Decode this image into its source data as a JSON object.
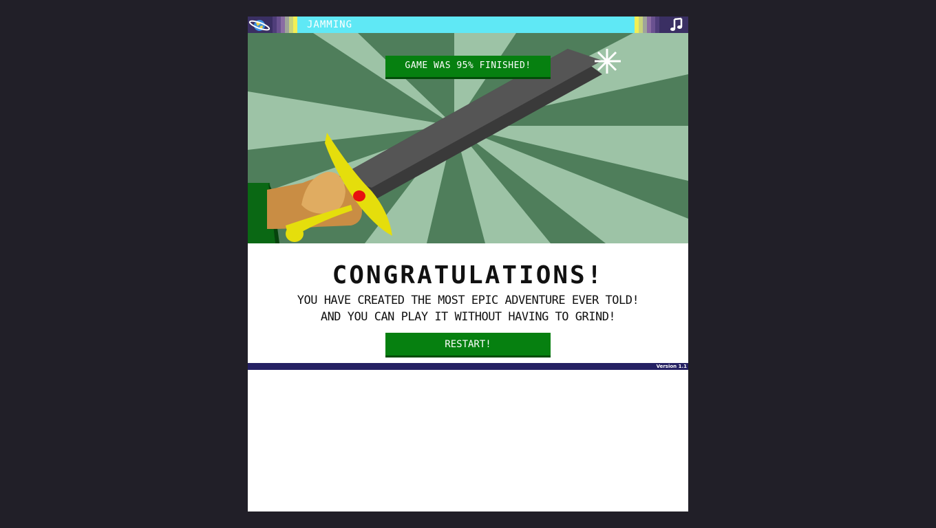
{
  "topbar": {
    "title": "JAMMING",
    "left_icon": "planet-icon",
    "right_icon": "music-note-icon",
    "bar_color": "#5fe8f5",
    "stripe_colors": [
      "#3a2f63",
      "#4f3d7a",
      "#6a5190",
      "#8a6ca3",
      "#9fa49a",
      "#c8d37a",
      "#f2ef55"
    ]
  },
  "scene": {
    "progress_label": "GAME WAS 95% FINISHED!",
    "progress_percent": 95,
    "colors": {
      "ray_dark": "#4f7e5b",
      "ray_light": "#9dc3a6",
      "blade_top": "#555555",
      "blade_side": "#3a3a3a",
      "hilt": "#e5de0c",
      "gem": "#e81010",
      "hand": "#c98d44",
      "hand_light": "#e0ac61",
      "sleeve": "#0a6814"
    }
  },
  "content": {
    "headline": "CONGRATULATIONS!",
    "line1": "YOU HAVE CREATED THE MOST EPIC ADVENTURE EVER TOLD!",
    "line2": "AND YOU CAN PLAY IT WITHOUT HAVING TO GRIND!",
    "restart_label": "RESTART!"
  },
  "footer": {
    "version": "Version 1.1"
  }
}
